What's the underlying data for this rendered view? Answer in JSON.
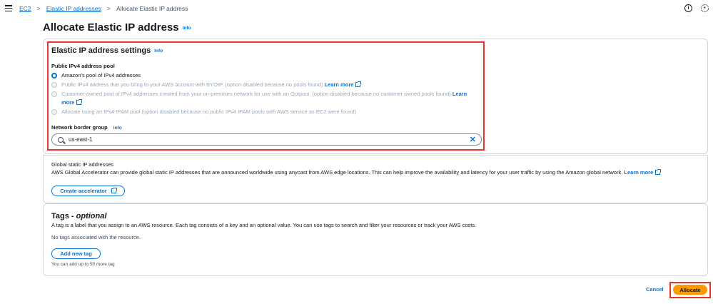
{
  "breadcrumb": {
    "items": [
      "EC2",
      "Elastic IP addresses"
    ],
    "current": "Allocate Elastic IP address",
    "separator": ">"
  },
  "header": {
    "title": "Allocate Elastic IP address",
    "info": "Info"
  },
  "settings": {
    "title": "Elastic IP address settings",
    "info": "Info",
    "pool_label": "Public IPv4 address pool",
    "options": [
      {
        "text": "Amazon's pool of IPv4 addresses",
        "selected": true,
        "disabled": false
      },
      {
        "text": "Public IPv4 address that you bring to your AWS account with BYOIP. (option disabled because no pools found)",
        "link": "Learn more",
        "selected": false,
        "disabled": true
      },
      {
        "text": "Customer-owned pool of IPv4 addresses created from your on-premises network for use with an Outpost. (option disabled because no customer owned pools found)",
        "link": "Learn more",
        "selected": false,
        "disabled": true
      },
      {
        "text": "Allocate using an IPv4 IPAM pool (option disabled because no public IPv4 IPAM pools with AWS service as EC2 were found)",
        "selected": false,
        "disabled": true
      }
    ],
    "border_group_label": "Network border group",
    "border_group_info": "Info",
    "border_group_value": "us-east-1"
  },
  "accelerator": {
    "title": "Global static IP addresses",
    "description": "AWS Global Accelerator can provide global static IP addresses that are announced worldwide using anycast from AWS edge locations. This can help improve the availability and latency for your user traffic by using the Amazon global network.",
    "learn_more": "Learn more",
    "button": "Create accelerator"
  },
  "tags": {
    "title": "Tags",
    "title_suffix": "optional",
    "separator": " - ",
    "description": "A tag is a label that you assign to an AWS resource. Each tag consists of a key and an optional value. You can use tags to search and filter your resources or track your AWS costs.",
    "empty": "No tags associated with the resource.",
    "add_button": "Add new tag",
    "limit": "You can add up to 50 more tag"
  },
  "footer": {
    "cancel": "Cancel",
    "allocate": "Allocate"
  },
  "colors": {
    "link": "#0972d3",
    "primary_button": "#ff9900",
    "highlight": "#e8352a"
  },
  "icons": [
    "menu-icon",
    "info-circle-icon",
    "settings-icon",
    "search-icon",
    "clear-icon",
    "external-link-icon"
  ]
}
